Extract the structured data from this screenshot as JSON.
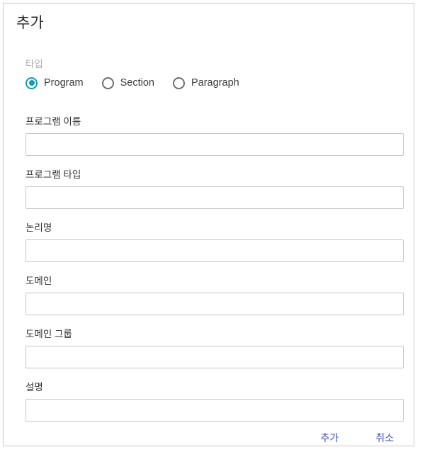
{
  "dialog": {
    "title": "추가",
    "accent_color": "#119bb4",
    "action_color": "#4055b8",
    "border_color": "#c9c9c9"
  },
  "type_field": {
    "legend": "타입",
    "selected": "Program",
    "options": [
      {
        "label": "Program",
        "selected": true
      },
      {
        "label": "Section",
        "selected": false
      },
      {
        "label": "Paragraph",
        "selected": false
      }
    ]
  },
  "fields": [
    {
      "label": "프로그램 이름",
      "value": "",
      "placeholder": ""
    },
    {
      "label": "프로그램 타입",
      "value": "",
      "placeholder": ""
    },
    {
      "label": "논리명",
      "value": "",
      "placeholder": ""
    },
    {
      "label": "도메인",
      "value": "",
      "placeholder": ""
    },
    {
      "label": "도메인 그룹",
      "value": "",
      "placeholder": ""
    },
    {
      "label": "설명",
      "value": "",
      "placeholder": ""
    }
  ],
  "actions": {
    "submit_label": "추가",
    "cancel_label": "취소"
  }
}
